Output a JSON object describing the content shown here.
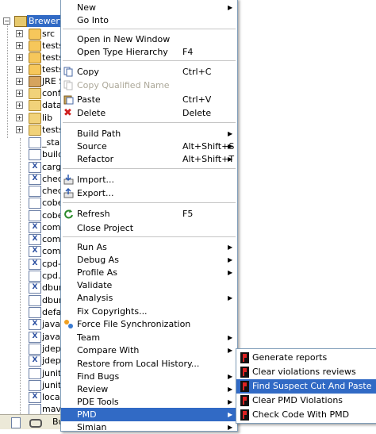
{
  "tree": {
    "project": "Brewery",
    "items": [
      "src",
      "tests",
      "tests",
      "tests",
      "JRE S",
      "confi",
      "datal",
      "lib",
      "tests",
      "_star",
      "build",
      "cargo",
      "chec",
      "chec",
      "cobe",
      "cobe",
      "comr",
      "comr",
      "comp",
      "cpd-b",
      "cpd.b",
      "dbun",
      "dbun",
      "defa",
      "javar",
      "javar",
      "jdepe",
      "jdepe",
      "junit-",
      "junit.",
      "local.",
      "mave"
    ],
    "bottom_tab": "Bu"
  },
  "menu": {
    "items": [
      {
        "label": "New",
        "accel": "",
        "arrow": true
      },
      {
        "label": "Go Into",
        "accel": ""
      },
      {
        "label": "Open in New Window",
        "accel": ""
      },
      {
        "label": "Open Type Hierarchy",
        "accel": "F4"
      },
      {
        "label": "Copy",
        "accel": "Ctrl+C",
        "icon": "copy-icon"
      },
      {
        "label": "Copy Qualified Name",
        "accel": "",
        "disabled": true,
        "icon": "copy-qualified-icon"
      },
      {
        "label": "Paste",
        "accel": "Ctrl+V",
        "icon": "paste-icon"
      },
      {
        "label": "Delete",
        "accel": "Delete",
        "icon": "delete-icon"
      },
      {
        "label": "Build Path",
        "accel": "",
        "arrow": true
      },
      {
        "label": "Source",
        "accel": "Alt+Shift+S",
        "arrow": true
      },
      {
        "label": "Refactor",
        "accel": "Alt+Shift+T",
        "arrow": true
      },
      {
        "label": "Import...",
        "accel": "",
        "icon": "import-icon"
      },
      {
        "label": "Export...",
        "accel": "",
        "icon": "export-icon"
      },
      {
        "label": "Refresh",
        "accel": "F5",
        "icon": "refresh-icon"
      },
      {
        "label": "Close Project",
        "accel": ""
      },
      {
        "label": "Run As",
        "accel": "",
        "arrow": true
      },
      {
        "label": "Debug As",
        "accel": "",
        "arrow": true
      },
      {
        "label": "Profile As",
        "accel": "",
        "arrow": true
      },
      {
        "label": "Validate",
        "accel": ""
      },
      {
        "label": "Analysis",
        "accel": "",
        "arrow": true
      },
      {
        "label": "Fix Copyrights...",
        "accel": ""
      },
      {
        "label": "Force File Synchronization",
        "accel": "",
        "icon": "sync-icon"
      },
      {
        "label": "Team",
        "accel": "",
        "arrow": true
      },
      {
        "label": "Compare With",
        "accel": "",
        "arrow": true
      },
      {
        "label": "Restore from Local History...",
        "accel": ""
      },
      {
        "label": "Find Bugs",
        "accel": "",
        "arrow": true
      },
      {
        "label": "Review",
        "accel": "",
        "arrow": true
      },
      {
        "label": "PDE Tools",
        "accel": "",
        "arrow": true
      },
      {
        "label": "PMD",
        "accel": "",
        "arrow": true,
        "highlighted": true
      },
      {
        "label": "Simian",
        "accel": "",
        "arrow": true
      }
    ]
  },
  "submenu": {
    "items": [
      {
        "label": "Generate reports"
      },
      {
        "label": "Clear violations reviews"
      },
      {
        "label": "Find Suspect Cut And Paste",
        "highlighted": true
      },
      {
        "label": "Clear PMD Violations"
      },
      {
        "label": "Check Code With PMD"
      }
    ]
  },
  "colors": {
    "highlight": "#316ac5",
    "menu_border": "#7f9db9",
    "disabled": "#aca899"
  }
}
